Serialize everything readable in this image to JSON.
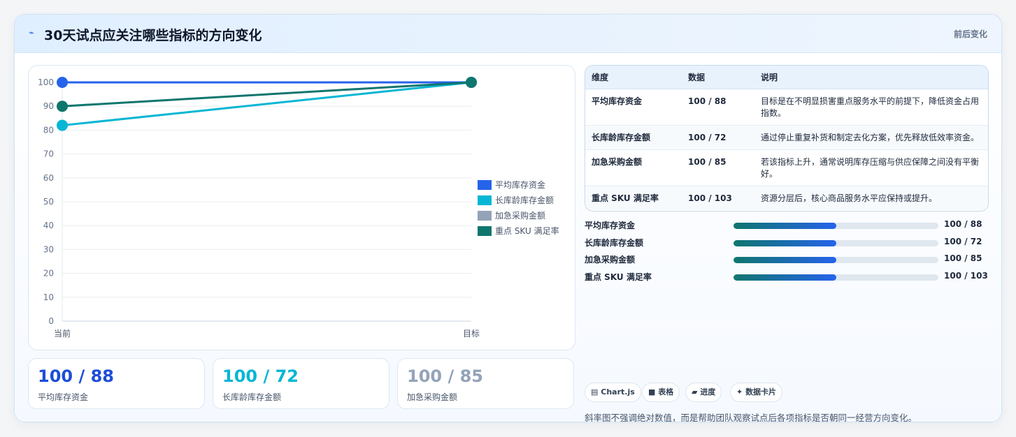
{
  "header": {
    "icon": "⌁",
    "title": "30天试点应关注哪些指标的方向变化",
    "tag": "前后变化"
  },
  "colors": {
    "series": [
      "#2563eb",
      "#06b6d4",
      "#94a3b8",
      "#0f766e"
    ],
    "stat_values": [
      "#1d4ed8",
      "#06b6d4",
      "#94a3b8"
    ]
  },
  "chart_data": {
    "type": "line",
    "categories": [
      "当前",
      "目标"
    ],
    "ylim": [
      0,
      100
    ],
    "yticks": [
      0,
      10,
      20,
      30,
      40,
      50,
      60,
      70,
      80,
      90,
      100
    ],
    "grid": true,
    "legend_position": "right",
    "series": [
      {
        "name": "平均库存资金",
        "values": [
          100,
          100
        ]
      },
      {
        "name": "长库龄库存金额",
        "values": [
          82,
          100
        ]
      },
      {
        "name": "加急采购金额",
        "values": [
          null,
          null
        ]
      },
      {
        "name": "重点 SKU 满足率",
        "values": [
          90,
          100
        ]
      }
    ]
  },
  "stat_cards": [
    {
      "value": "100 / 88",
      "label": "平均库存资金"
    },
    {
      "value": "100 / 72",
      "label": "长库龄库存金额"
    },
    {
      "value": "100 / 85",
      "label": "加急采购金额"
    }
  ],
  "table": {
    "headers": [
      "维度",
      "数据",
      "说明"
    ],
    "rows": [
      {
        "dim": "平均库存资金",
        "data": "100 / 88",
        "desc": "目标是在不明显损害重点服务水平的前提下，降低资金占用指数。"
      },
      {
        "dim": "长库龄库存金额",
        "data": "100 / 72",
        "desc": "通过停止重复补货和制定去化方案，优先释放低效率资金。"
      },
      {
        "dim": "加急采购金额",
        "data": "100 / 85",
        "desc": "若该指标上升，通常说明库存压缩与供应保障之间没有平衡好。"
      },
      {
        "dim": "重点 SKU 满足率",
        "data": "100 / 103",
        "desc": "资源分层后，核心商品服务水平应保持或提升。"
      }
    ]
  },
  "progress": [
    {
      "label": "平均库存资金",
      "value": "100 / 88",
      "fill_fraction": 0.5
    },
    {
      "label": "长库龄库存金额",
      "value": "100 / 72",
      "fill_fraction": 0.5
    },
    {
      "label": "加急采购金额",
      "value": "100 / 85",
      "fill_fraction": 0.5
    },
    {
      "label": "重点 SKU 满足率",
      "value": "100 / 103",
      "fill_fraction": 0.5
    }
  ],
  "chips": [
    {
      "icon": "▤",
      "label": "Chart.js"
    },
    {
      "icon": "■",
      "label": "表格"
    },
    {
      "icon": "▰",
      "label": "进度"
    },
    {
      "icon": "✦",
      "label": "数据卡片"
    }
  ],
  "footnote": "斜率图不强调绝对数值，而是帮助团队观察试点后各项指标是否朝同一经营方向变化。"
}
